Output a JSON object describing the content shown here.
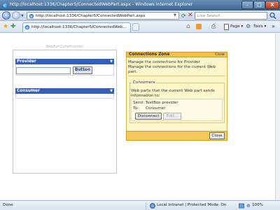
{
  "window": {
    "title": "http://localhost:1336/Chapter5/ConnectedWebPart.aspx - Windows Internet Explorer",
    "min_label": "–",
    "max_label": "□",
    "close_label": "X"
  },
  "addressbar": {
    "url": "http://localhost:1336/Chapter5/ConnectedWebPart.aspx",
    "search_placeholder": "Live Search"
  },
  "toolbar": {
    "tab_title": "http://localhost:1336/Chapter5/ConnectedWeb...",
    "page_label": "Page ▾",
    "tools_label": "Tools ▾"
  },
  "content": {
    "zone_title": "WebPartZoneProvider",
    "provider": {
      "title": "Provider",
      "button_label": "Button"
    },
    "consumer": {
      "title": "Consumer"
    },
    "connections": {
      "title": "Connections Zone",
      "close_link": "Close",
      "line1": "Manage the connections for Provider",
      "line2": "Manage the connections for the current Web",
      "line3": "part.",
      "consumers_legend": "Consumers",
      "info1": "Web parts that the current Web part sends",
      "info2": "information to:",
      "send_label": "Send: TextBox provider",
      "to_label": "To:",
      "to_value": "Consumer",
      "disconnect_label": "Disconnect",
      "edit_label": "Edit...",
      "close_button": "Close"
    }
  },
  "status": {
    "done": "Done",
    "zone": "Local intranet | Protected Mode: On",
    "zoom": "100%"
  },
  "colors": {
    "webpart_header": "#3560b8",
    "connections_header": "#f3c24a",
    "connections_body": "#fff7cc"
  }
}
